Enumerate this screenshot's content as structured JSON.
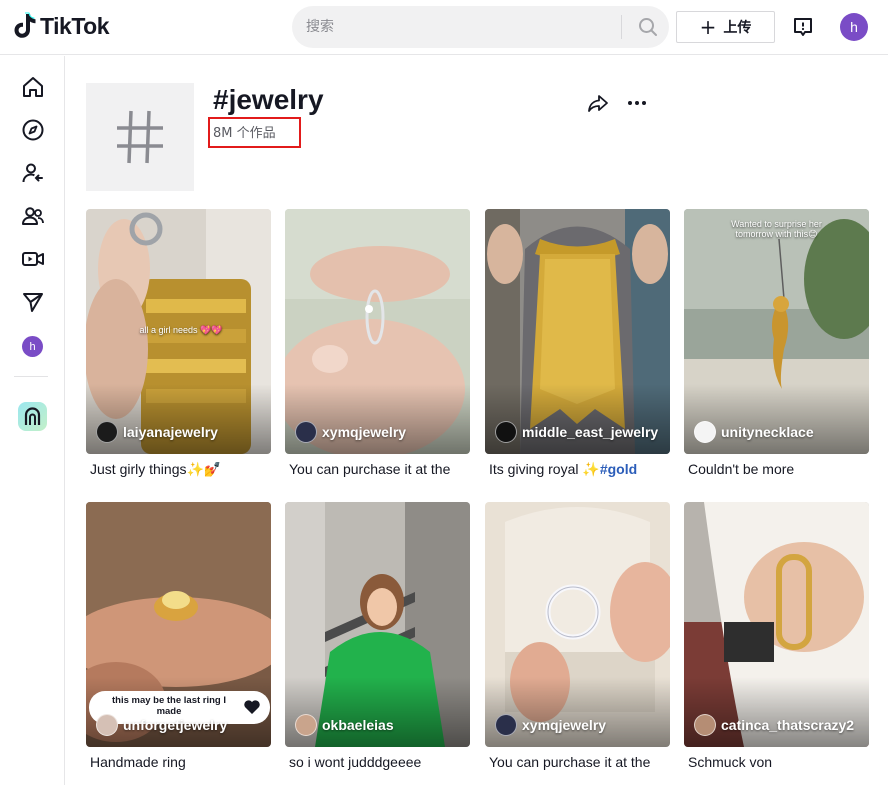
{
  "header": {
    "brand": "TikTok",
    "search_placeholder": "搜索",
    "upload_label": "上传",
    "user_initial": "h"
  },
  "sidebar": {
    "items": [
      "home-icon",
      "explore-icon",
      "following-icon",
      "friends-icon",
      "live-icon",
      "messages-icon"
    ],
    "user_initial": "h"
  },
  "tag": {
    "title": "#jewelry",
    "count": "8M 个作品"
  },
  "videos": [
    {
      "author": "laiyanajewelry",
      "caption": "Just girly things✨💅",
      "overlay": "all a girl needs 💖💖"
    },
    {
      "author": "xymqjewelry",
      "caption": "You can purchase it at the",
      "overlay": ""
    },
    {
      "author": "middle_east_jewelry",
      "caption": "Its giving royal ✨",
      "hashtag": "#gold",
      "overlay": ""
    },
    {
      "author": "unitynecklace",
      "caption": "Couldn't be more",
      "overlay": "Wanted to surprise her tomorrow with this😊"
    },
    {
      "author": "unforgetjewelry",
      "caption": "Handmade ring",
      "overlay": "this may be the last ring I made"
    },
    {
      "author": "okbaeleias",
      "caption": "so i wont judddgeeee",
      "overlay": ""
    },
    {
      "author": "xymqjewelry",
      "caption": "You can purchase it at the",
      "overlay": ""
    },
    {
      "author": "catinca_thatscrazy2",
      "caption": "Schmuck von",
      "overlay": ""
    }
  ],
  "colors": {
    "accent": "#fe2c55",
    "avatar": "#7a4cc6",
    "highlight": "#e21b1b",
    "hashtag": "#2b5db9"
  }
}
